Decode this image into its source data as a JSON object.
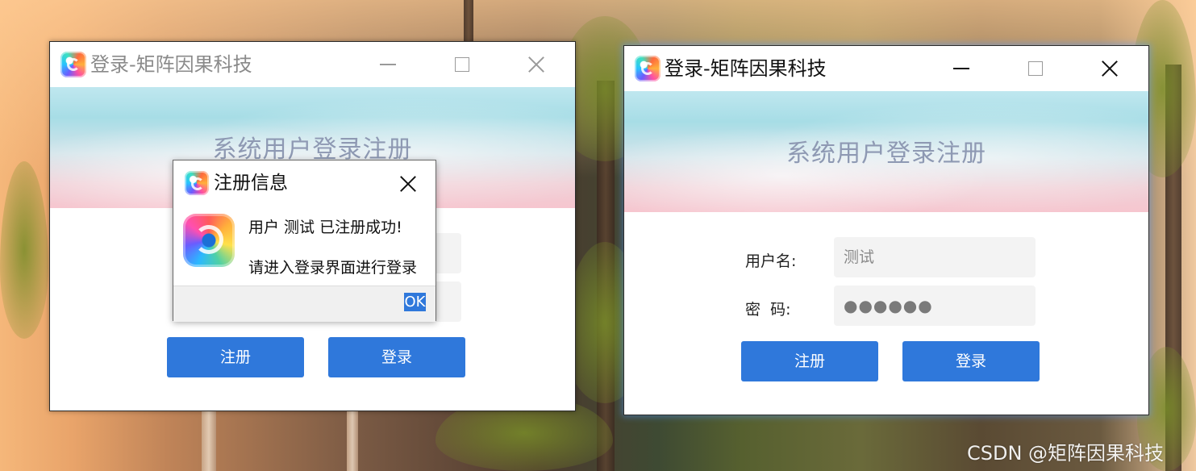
{
  "left_window": {
    "title": "登录-矩阵因果科技",
    "banner_title": "系统用户登录注册",
    "register_button": "注册",
    "login_button": "登录"
  },
  "right_window": {
    "title": "登录-矩阵因果科技",
    "banner_title": "系统用户登录注册",
    "username_label": "用户名:",
    "username_value": "测试",
    "password_label": "密  码:",
    "password_value": "●●●●●●",
    "register_button": "注册",
    "login_button": "登录"
  },
  "message_box": {
    "title": "注册信息",
    "line1": "用户 测试 已注册成功!",
    "line2": "请进入登录界面进行登录",
    "ok_button": "OK"
  },
  "watermark": "CSDN @矩阵因果科技",
  "icons": {
    "app": "app-logo-icon",
    "minimize": "minimize-icon",
    "maximize": "maximize-icon",
    "close": "close-icon"
  },
  "colors": {
    "primary_button": "#2f78db",
    "banner_title": "#8e99b3",
    "input_background": "#f3f3f3",
    "active_window_glow": "#5096ff"
  }
}
